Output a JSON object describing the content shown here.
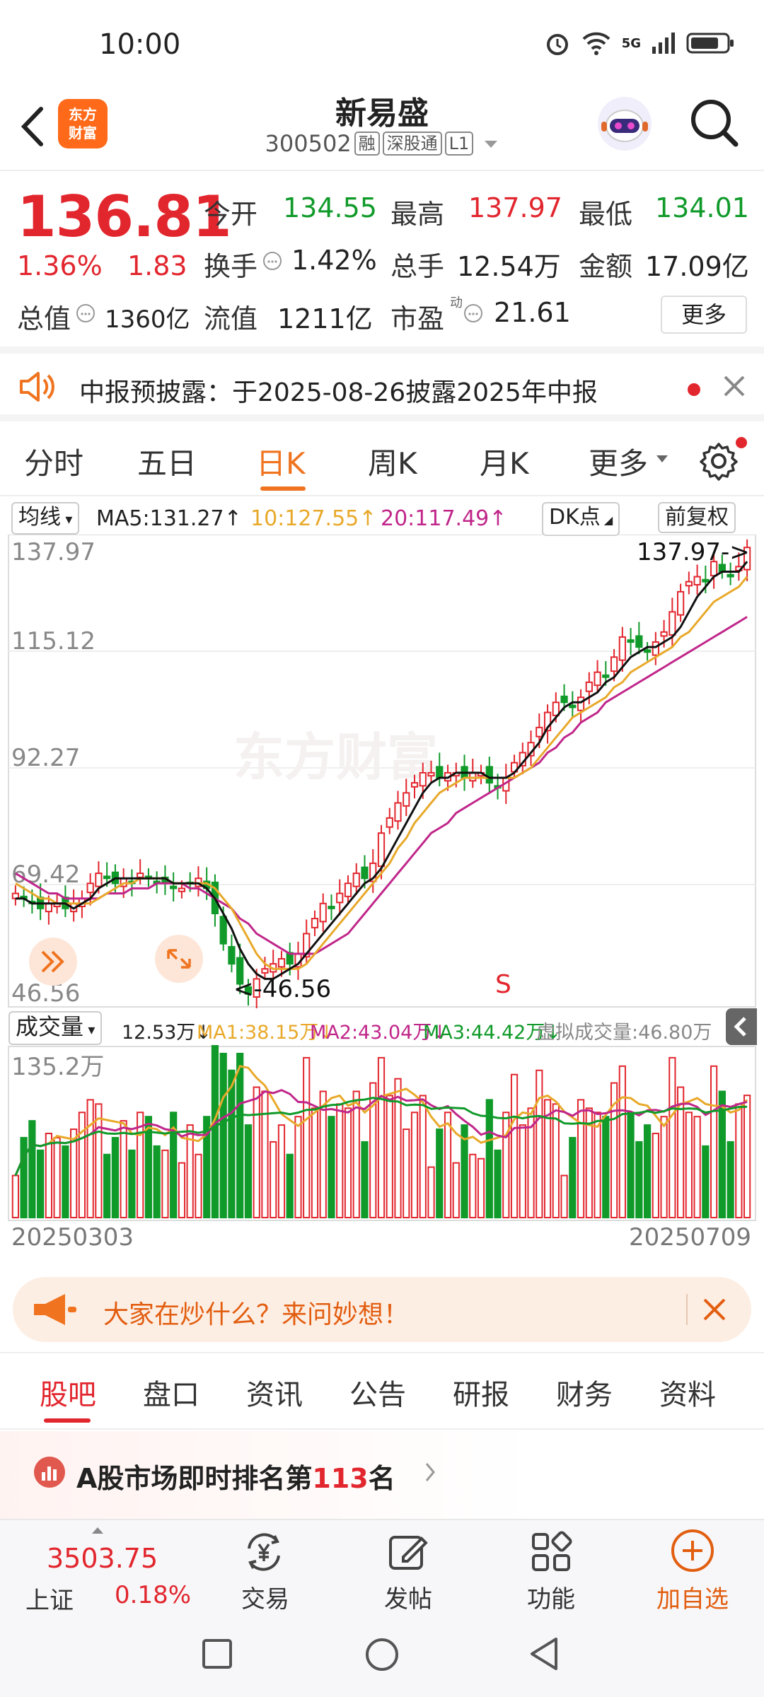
{
  "status_bar": {
    "time": "10:00",
    "network": "5G"
  },
  "header": {
    "logo_text_1": "东方",
    "logo_text_2": "财富",
    "stock_name": "新易盛",
    "stock_code": "300502",
    "tags": [
      "融",
      "深股通",
      "L1"
    ]
  },
  "quote": {
    "price": "136.81",
    "change_pct": "1.36%",
    "change": "1.83",
    "open_label": "今开",
    "open": "134.55",
    "high_label": "最高",
    "high": "137.97",
    "low_label": "最低",
    "low": "134.01",
    "turnover_label": "换手",
    "turnover": "1.42%",
    "volume_label": "总手",
    "volume": "12.54万",
    "amount_label": "金额",
    "amount": "17.09亿",
    "mcap_label": "总值",
    "mcap": "1360亿",
    "float_label": "流值",
    "float": "1211亿",
    "pe_label": "市盈",
    "pe_sup": "动",
    "pe": "21.61",
    "more_label": "更多"
  },
  "notice": {
    "text": "中报预披露：于2025-08-26披露2025年中报"
  },
  "period_tabs": [
    "分时",
    "五日",
    "日K",
    "周K",
    "月K",
    "更多"
  ],
  "period_active": "日K",
  "ma_bar": {
    "selector": "均线",
    "ma5": "MA5:131.27↑",
    "ma10": "10:127.55↑",
    "ma20": "20:117.49↑",
    "dk_label": "DK点",
    "adjust_label": "前复权"
  },
  "colors": {
    "up": "#e2262e",
    "down": "#109a2a",
    "ma5": "#111111",
    "ma10": "#e8a92a",
    "ma20": "#c0268a",
    "accent": "#f0731f"
  },
  "chart_data": {
    "type": "candlestick",
    "y_ticks": [
      "137.97",
      "115.12",
      "92.27",
      "69.42",
      "46.56"
    ],
    "ylim": [
      46.56,
      137.97
    ],
    "max_annotation": "137.97->",
    "min_annotation": "<-46.56",
    "signal_label": "S",
    "date_start": "20250303",
    "date_end": "20250709",
    "close": [
      68,
      67,
      66,
      65,
      66,
      66,
      65,
      66,
      67,
      70,
      72,
      71,
      70,
      71,
      70,
      72,
      71,
      70,
      70,
      69,
      69,
      70,
      71,
      69,
      64,
      58,
      54,
      50,
      48,
      51,
      53,
      54,
      55,
      54,
      56,
      60,
      63,
      66,
      65,
      68,
      70,
      72,
      71,
      74,
      80,
      83,
      86,
      88,
      90,
      92,
      92,
      91,
      92,
      92,
      91,
      92,
      92,
      90,
      89,
      91,
      94,
      96,
      98,
      101,
      104,
      106,
      106,
      105,
      107,
      110,
      112,
      111,
      115,
      119,
      118,
      117,
      116,
      118,
      120,
      124,
      128,
      130,
      131,
      130,
      134,
      132,
      131,
      133,
      136.81
    ],
    "ma5": [
      67,
      67,
      66,
      66,
      66,
      66,
      66,
      65,
      66,
      67,
      69,
      70,
      71,
      71,
      71,
      71,
      71,
      71,
      71,
      70,
      70,
      70,
      70,
      69,
      67,
      64,
      61,
      57,
      54,
      52,
      51,
      51,
      52,
      53,
      54,
      56,
      58,
      60,
      62,
      64,
      66,
      68,
      70,
      71,
      73,
      76,
      79,
      82,
      85,
      88,
      90,
      91,
      91,
      92,
      92,
      92,
      92,
      91,
      91,
      91,
      92,
      94,
      96,
      98,
      101,
      103,
      105,
      106,
      106,
      107,
      108,
      110,
      111,
      113,
      115,
      116,
      117,
      117,
      118,
      119,
      121,
      124,
      127,
      129,
      131,
      132,
      132,
      132,
      134
    ],
    "ma10": [
      70,
      69,
      68,
      67,
      67,
      66,
      66,
      66,
      66,
      66,
      67,
      68,
      69,
      70,
      70,
      71,
      71,
      71,
      71,
      70,
      70,
      70,
      70,
      70,
      69,
      67,
      65,
      62,
      59,
      56,
      54,
      53,
      53,
      53,
      53,
      54,
      56,
      58,
      60,
      62,
      64,
      66,
      68,
      70,
      72,
      74,
      77,
      79,
      82,
      84,
      86,
      88,
      89,
      90,
      91,
      91,
      91,
      91,
      91,
      91,
      91,
      92,
      93,
      95,
      97,
      99,
      101,
      103,
      104,
      105,
      106,
      107,
      109,
      110,
      112,
      113,
      114,
      115,
      116,
      117,
      119,
      120,
      122,
      124,
      126,
      127,
      128,
      129,
      131
    ],
    "ma20": [
      72,
      71,
      70,
      69,
      68,
      68,
      67,
      67,
      67,
      67,
      67,
      68,
      68,
      68,
      69,
      69,
      69,
      70,
      70,
      70,
      70,
      69,
      69,
      68,
      67,
      66,
      65,
      63,
      62,
      60,
      59,
      58,
      57,
      56,
      56,
      56,
      56,
      57,
      58,
      59,
      60,
      62,
      64,
      66,
      68,
      70,
      72,
      74,
      76,
      78,
      80,
      81,
      82,
      84,
      85,
      86,
      87,
      88,
      89,
      90,
      91,
      92,
      93,
      94,
      96,
      97,
      99,
      100,
      102,
      103,
      104,
      106,
      107,
      108,
      109,
      110,
      111,
      112,
      113,
      114,
      115,
      116,
      117,
      118,
      119,
      120,
      121,
      122,
      123
    ],
    "volume_unit": "万",
    "volume_max_label": "135.2万",
    "volume_label": "成交量",
    "volume_current": "12.53万↓",
    "vol_ma1": "MA1:38.15万↓",
    "vol_ma2": "MA2:43.04万↓",
    "vol_ma3": "MA3:44.42万↓",
    "virtual_volume": "虚拟成交量:46.80万"
  },
  "ask_banner": {
    "text": "大家在炒什么？来问妙想！"
  },
  "section_tabs": [
    "股吧",
    "盘口",
    "资讯",
    "公告",
    "研报",
    "财务",
    "资料"
  ],
  "section_active": "股吧",
  "ranking": {
    "prefix": "A股市场即时排名第",
    "rank": "113",
    "suffix": "名"
  },
  "bottom_nav": {
    "index_value": "3503.75",
    "index_name": "上证",
    "index_pct": "0.18%",
    "trade": "交易",
    "post": "发帖",
    "function": "功能",
    "add_watch": "加自选"
  }
}
